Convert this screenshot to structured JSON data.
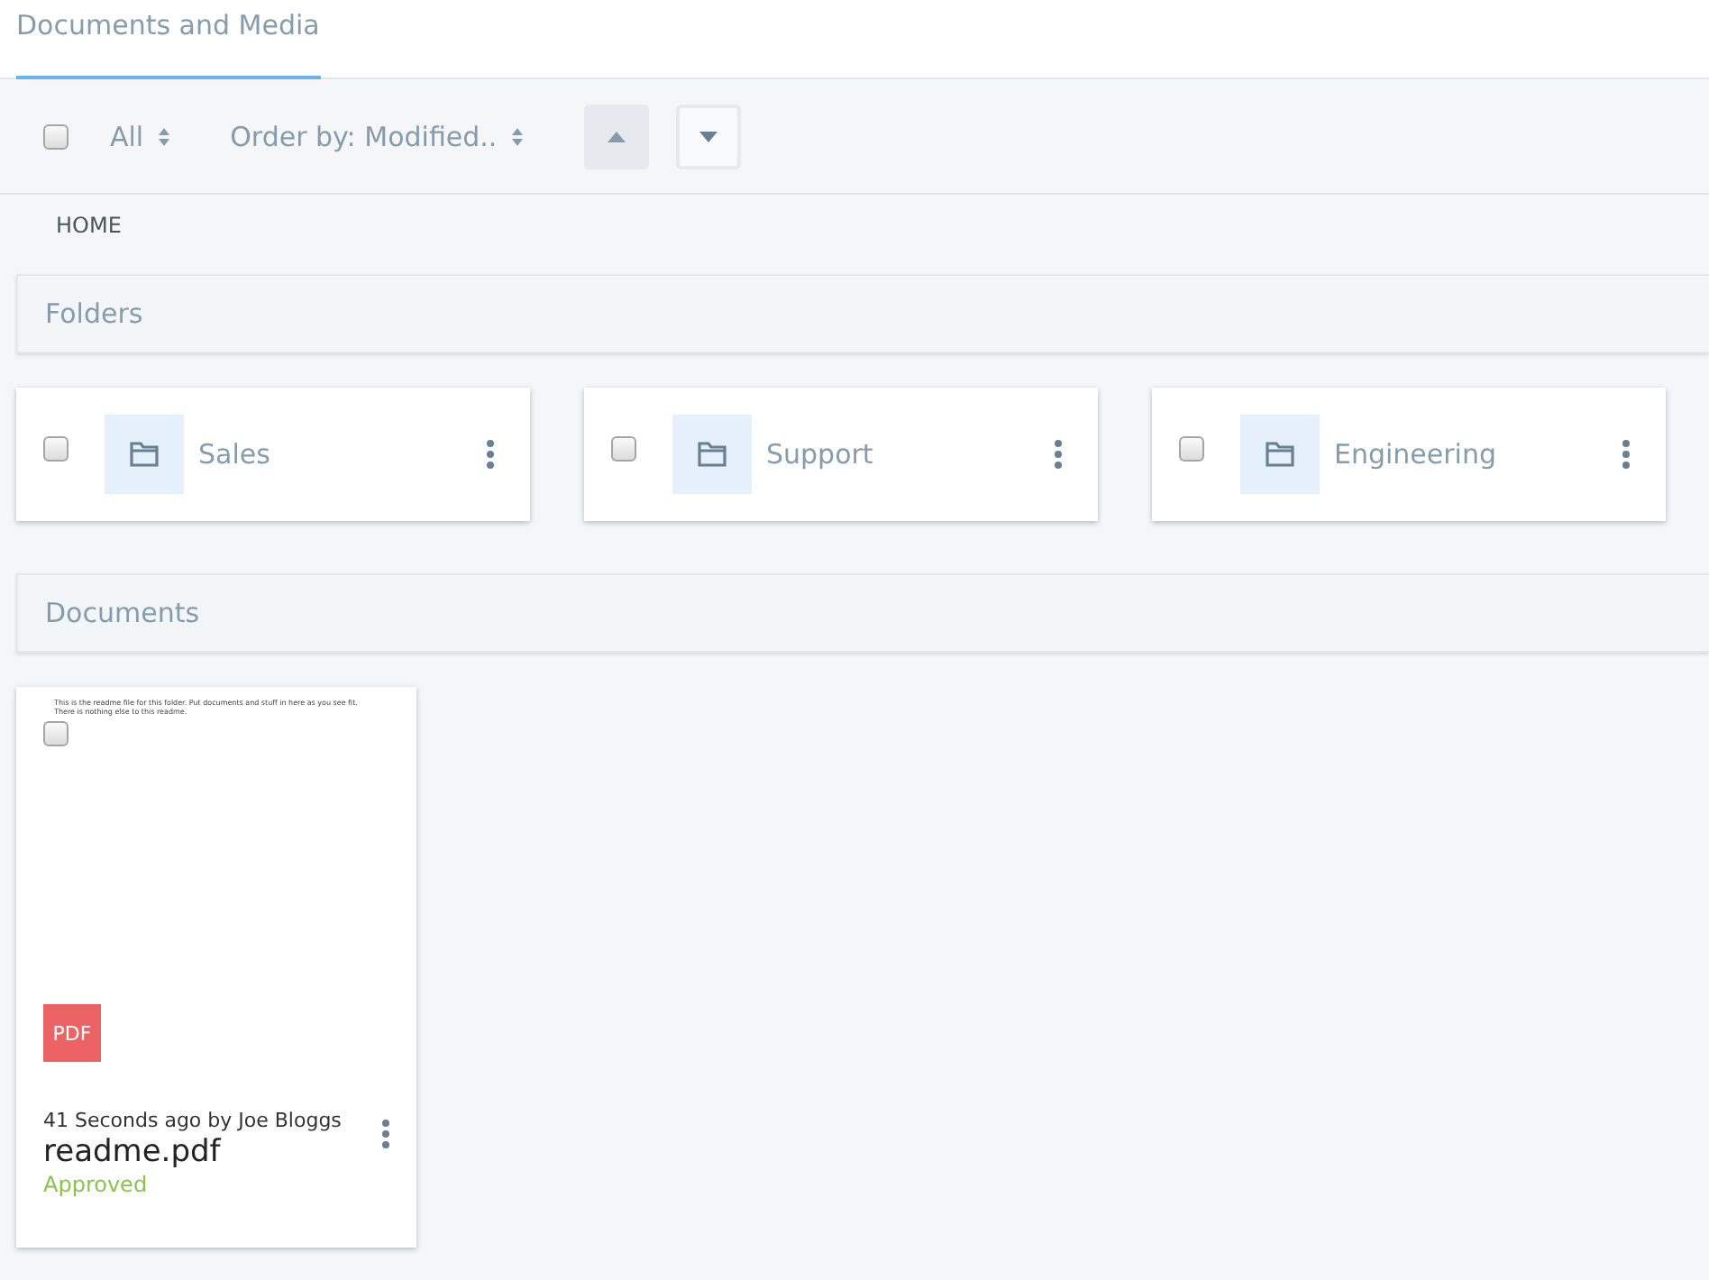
{
  "tabs": [
    {
      "label": "Documents and Media",
      "selected": true
    }
  ],
  "toolbar": {
    "select_all": {
      "checked": false
    },
    "filter": {
      "label": "All"
    },
    "order": {
      "label": "Order by: Modified.."
    },
    "sort_buttons": [
      {
        "kind": "ascending",
        "selected": true
      },
      {
        "kind": "descending",
        "selected": false
      }
    ]
  },
  "breadcrumb": [
    "HOME"
  ],
  "folders_section": {
    "title": "Folders",
    "items": [
      {
        "name": "Sales",
        "checked": false
      },
      {
        "name": "Support",
        "checked": false
      },
      {
        "name": "Engineering",
        "checked": false
      }
    ]
  },
  "documents_section": {
    "title": "Documents",
    "items": [
      {
        "preview_text": "This is the readme file for this folder. Put documents and stuff in here as you see fit. There is nothing else to this readme.",
        "checked": false,
        "type_badge": "PDF",
        "meta": "41 Seconds ago by Joe Bloggs",
        "name": "readme.pdf",
        "status": "Approved"
      }
    ]
  }
}
